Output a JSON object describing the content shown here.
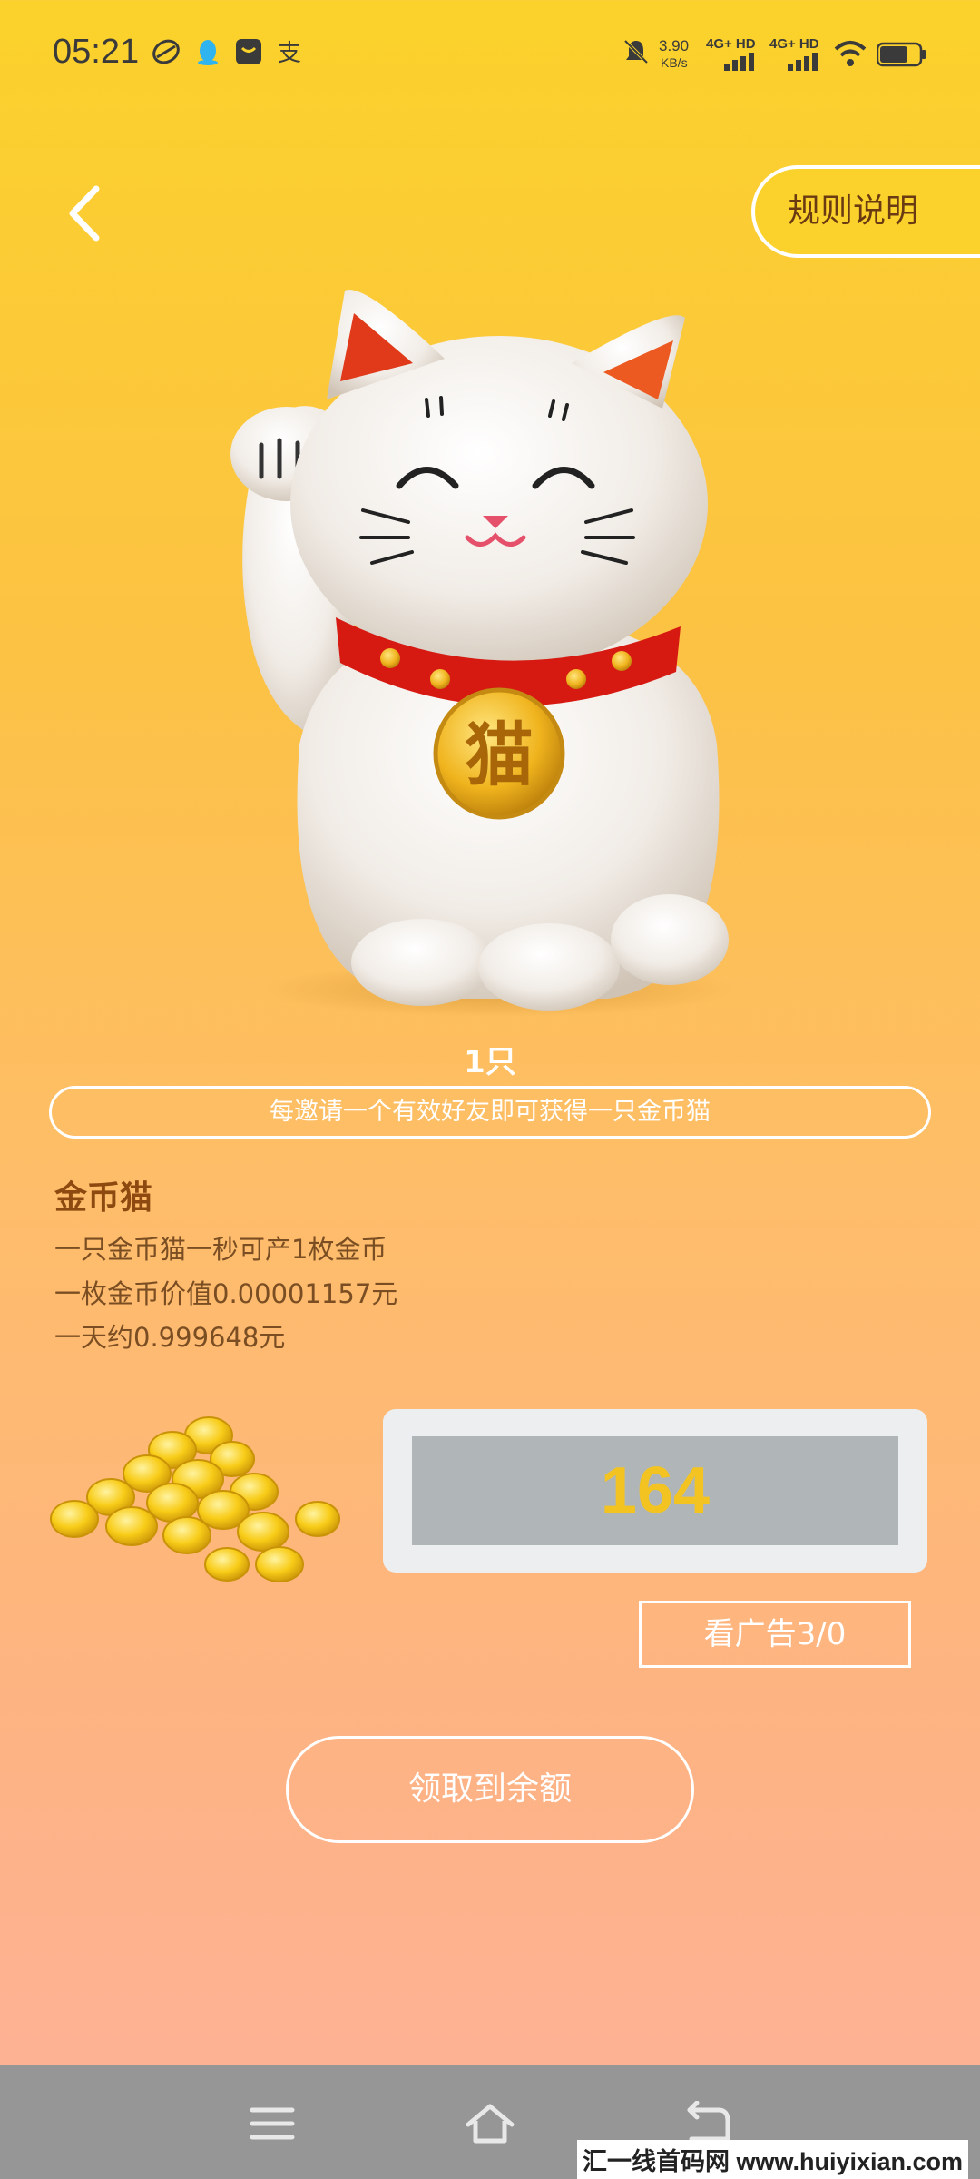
{
  "status_bar": {
    "time": "05:21",
    "net_speed_value": "3.90",
    "net_speed_unit": "KB/s",
    "signal1": "4G+ HD",
    "signal2": "4G+ HD",
    "icons": [
      "app-icon",
      "qq-icon",
      "message-icon",
      "alipay-icon",
      "mute-bell-icon",
      "wifi-icon",
      "battery-icon"
    ]
  },
  "header": {
    "back_icon": "chevron-left-icon",
    "rules_label": "规则说明"
  },
  "cat": {
    "count_label": "1只",
    "medal_char": "猫"
  },
  "notice": "每邀请一个有效好友即可获得一只金币猫",
  "info": {
    "title": "金币猫",
    "lines": [
      "一只金币猫一秒可产1枚金币",
      "一枚金币价值0.00001157元",
      "一天约0.999648元"
    ]
  },
  "coins": {
    "count": "164"
  },
  "ad_button": "看广告3/0",
  "claim_button": "领取到余额",
  "nav": {
    "icons": [
      "menu-icon",
      "home-icon",
      "back-icon"
    ]
  },
  "watermark": "汇一线首码网 www.huiyixian.com",
  "colors": {
    "accent_yellow": "#fbd22b",
    "coin_gold": "#f3c421",
    "title_brown": "#8c4a10"
  }
}
